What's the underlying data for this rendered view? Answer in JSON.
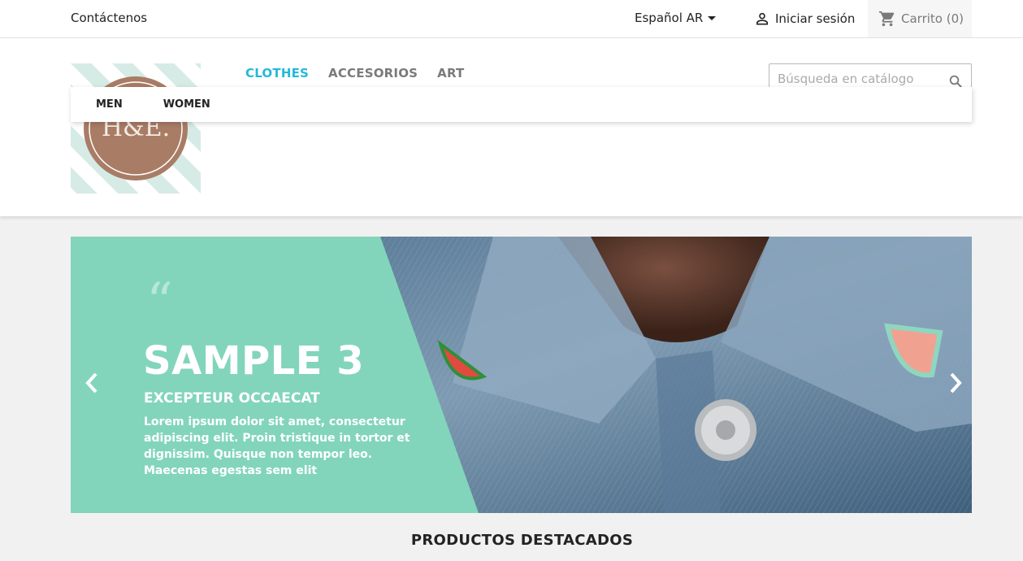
{
  "topbar": {
    "contact": "Contáctenos",
    "language": "Español AR",
    "login": "Iniciar sesión",
    "cart": "Carrito (0)"
  },
  "header": {
    "logo_text": "H&E.",
    "nav": [
      {
        "label": "CLOTHES",
        "active": true
      },
      {
        "label": "ACCESORIOS",
        "active": false
      },
      {
        "label": "ART",
        "active": false
      }
    ],
    "search": {
      "placeholder": "Búsqueda en catálogo"
    },
    "submenu": [
      "MEN",
      "WOMEN"
    ]
  },
  "slider": {
    "quote": "“",
    "title": "SAMPLE 3",
    "subtitle": "EXCEPTEUR OCCAECAT",
    "text": "Lorem ipsum dolor sit amet, consectetur adipiscing elit. Proin tristique in tortor et dignissim. Quisque non tempor leo. Maecenas egestas sem elit"
  },
  "featured": {
    "title": "PRODUCTOS DESTACADOS"
  },
  "colors": {
    "accent": "#24b9d7",
    "slide_panel": "#82d5bb",
    "logo_circle": "#a97c66",
    "logo_stripes": "#d6ebe5"
  }
}
